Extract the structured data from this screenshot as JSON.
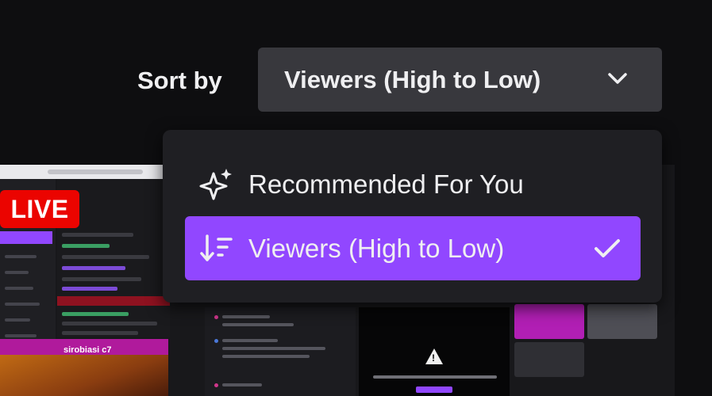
{
  "sort": {
    "label": "Sort by",
    "selected": "Viewers (High to Low)",
    "chevron_icon": "chevron-down-icon"
  },
  "menu": {
    "items": [
      {
        "label": "Recommended For You",
        "icon": "sparkle-icon",
        "selected": false
      },
      {
        "label": "Viewers (High to Low)",
        "icon": "sort-descending-icon",
        "selected": true
      }
    ],
    "check_icon": "checkmark-icon"
  },
  "thumbnail": {
    "badge": "LIVE",
    "overlay_text": "sirobiasi c7"
  },
  "colors": {
    "background": "#0e0e10",
    "select_bg": "#38383d",
    "menu_bg": "#1f1f23",
    "accent": "#9147ff",
    "live": "#eb0400",
    "text": "#efeff1"
  }
}
